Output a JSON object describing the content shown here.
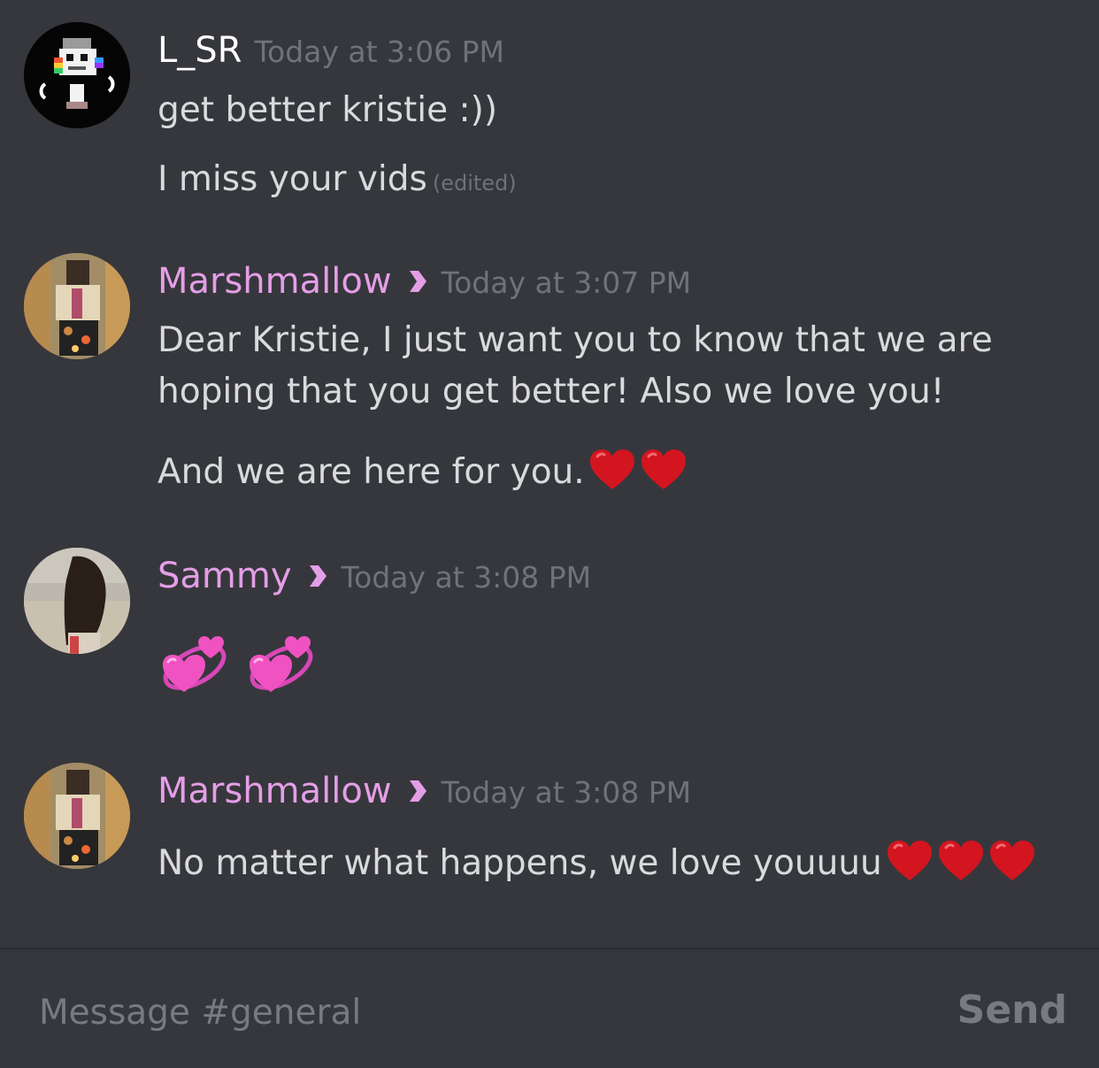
{
  "messages": [
    {
      "username": "L_SR",
      "username_color": "#ffffff",
      "timestamp": "Today at 3:06 PM",
      "avatar": "skeleton-character-avatar",
      "lines": [
        "get better kristie :))",
        "I miss your vids"
      ],
      "edited_label": "(edited)"
    },
    {
      "username": "Marshmallow",
      "username_color": "#e49ee6",
      "timestamp": "Today at 3:07 PM",
      "avatar": "roblox-character-avatar",
      "badge": "pink-chevron-badge",
      "lines": [
        "Dear Kristie, I just want you to know that we are",
        "hoping that you get better! Also we love you!",
        "And we are here for you."
      ]
    },
    {
      "username": "Sammy",
      "username_color": "#e49ee6",
      "timestamp": "Today at 3:08 PM",
      "avatar": "girl-photo-avatar",
      "badge": "pink-chevron-badge",
      "emojis": [
        "revolving-hearts",
        "revolving-hearts"
      ]
    },
    {
      "username": "Marshmallow",
      "username_color": "#e49ee6",
      "timestamp": "Today at 3:08 PM",
      "avatar": "roblox-character-avatar",
      "badge": "pink-chevron-badge",
      "lines": [
        "No matter what happens, we love youuuu"
      ]
    }
  ],
  "composer": {
    "placeholder": "Message #general",
    "send_label": "Send"
  },
  "colors": {
    "background": "#36373c",
    "text": "#d9dadc",
    "timestamp": "#70727a",
    "role_pink": "#e49ee6",
    "heart_red": "#d3151f"
  }
}
